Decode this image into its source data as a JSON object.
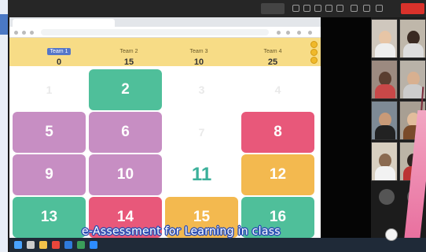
{
  "zoom": {
    "view_label": "",
    "end_label": ""
  },
  "browser": {
    "tab_title": "",
    "url": ""
  },
  "teams": [
    {
      "name": "Team 1",
      "score": "0",
      "active": true
    },
    {
      "name": "Team 2",
      "score": "15",
      "active": false
    },
    {
      "name": "Team 3",
      "score": "10",
      "active": false
    },
    {
      "name": "Team 4",
      "score": "25",
      "active": false
    }
  ],
  "tiles": [
    {
      "label": "1",
      "color": "ghost"
    },
    {
      "label": "2",
      "color": "green"
    },
    {
      "label": "3",
      "color": "ghost"
    },
    {
      "label": "4",
      "color": "ghost"
    },
    {
      "label": "5",
      "color": "purple"
    },
    {
      "label": "6",
      "color": "purple"
    },
    {
      "label": "7",
      "color": "ghost"
    },
    {
      "label": "8",
      "color": "pink"
    },
    {
      "label": "9",
      "color": "purple"
    },
    {
      "label": "10",
      "color": "purple"
    },
    {
      "label": "11",
      "color": "current"
    },
    {
      "label": "12",
      "color": "orange"
    },
    {
      "label": "13",
      "color": "green"
    },
    {
      "label": "14",
      "color": "pink"
    },
    {
      "label": "15",
      "color": "orange"
    },
    {
      "label": "16",
      "color": "green"
    }
  ],
  "caption": "e-Assessment for Learning in class",
  "colors": {
    "score_bar": "#f7dc86",
    "green_tile": "#4fbf9a",
    "purple_tile": "#c78ec3",
    "pink_tile": "#e8587a",
    "orange_tile": "#f3b94f",
    "active_team": "#5476c9"
  }
}
